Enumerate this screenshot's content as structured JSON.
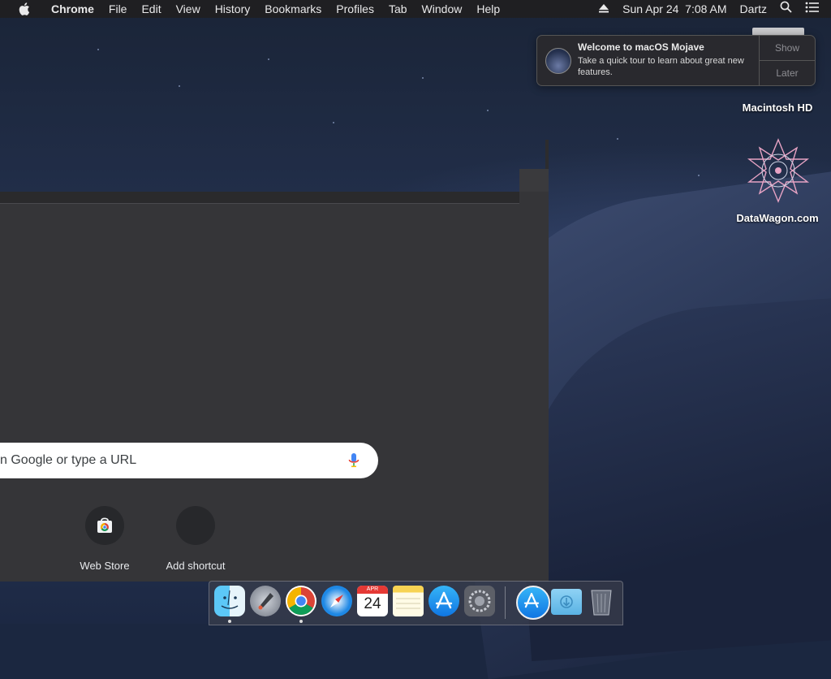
{
  "menubar": {
    "app_name": "Chrome",
    "menus": [
      "File",
      "Edit",
      "View",
      "History",
      "Bookmarks",
      "Profiles",
      "Tab",
      "Window",
      "Help"
    ],
    "datetime": "Sun Apr 24  7:08 AM",
    "user": "Dartz"
  },
  "notification": {
    "title": "Welcome to macOS Mojave",
    "body": "Take a quick tour to learn about great new features.",
    "show_label": "Show",
    "later_label": "Later"
  },
  "desktop": {
    "icons": [
      {
        "label": "Macintosh HD",
        "icon": "hard-drive-icon"
      },
      {
        "label": "DataWagon.com",
        "icon": "datawagon-logo-icon"
      }
    ]
  },
  "browser": {
    "search_placeholder": "n Google or type a URL",
    "shortcuts": [
      {
        "label": "Web Store",
        "icon": "chrome-web-store-icon"
      },
      {
        "label": "Add shortcut",
        "icon": "add-shortcut-icon"
      }
    ]
  },
  "dock": {
    "apps": [
      {
        "name": "Finder",
        "icon": "finder-icon",
        "running": true
      },
      {
        "name": "Launchpad",
        "icon": "launchpad-icon",
        "running": false
      },
      {
        "name": "Google Chrome",
        "icon": "chrome-icon",
        "running": true
      },
      {
        "name": "Safari",
        "icon": "safari-icon",
        "running": false
      },
      {
        "name": "Calendar",
        "icon": "calendar-icon",
        "running": false
      },
      {
        "name": "Notes",
        "icon": "notes-icon",
        "running": false
      },
      {
        "name": "App Store",
        "icon": "app-store-icon",
        "running": false
      },
      {
        "name": "System Preferences",
        "icon": "system-preferences-icon",
        "running": false
      },
      {
        "name": "App Store Downloads",
        "icon": "app-store-downloads-icon",
        "running": false
      },
      {
        "name": "Downloads",
        "icon": "downloads-folder-icon",
        "running": false
      },
      {
        "name": "Trash",
        "icon": "trash-icon",
        "running": false
      }
    ],
    "calendar": {
      "month": "APR",
      "day": "24"
    }
  }
}
